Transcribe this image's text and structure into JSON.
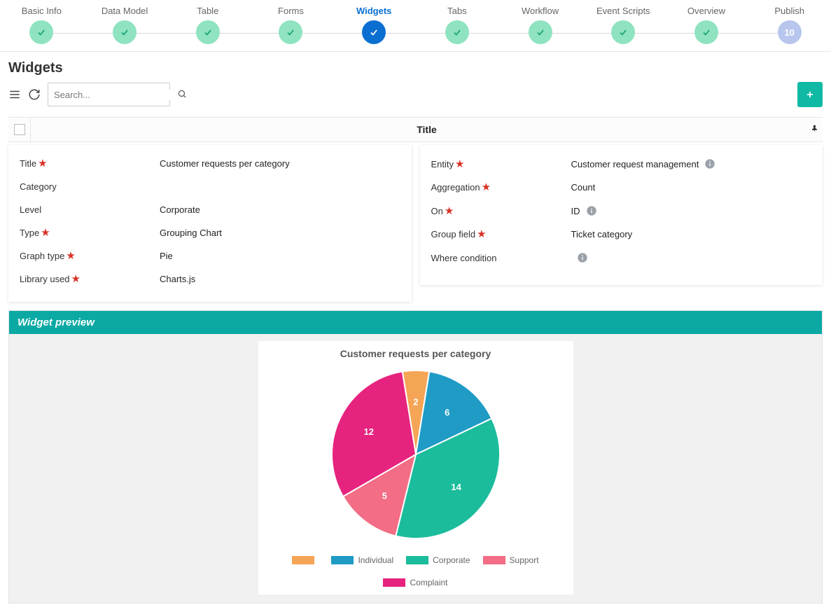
{
  "stepper": [
    {
      "label": "Basic Info",
      "done": true
    },
    {
      "label": "Data Model",
      "done": true
    },
    {
      "label": "Table",
      "done": true
    },
    {
      "label": "Forms",
      "done": true
    },
    {
      "label": "Widgets",
      "active": true
    },
    {
      "label": "Tabs",
      "done": true
    },
    {
      "label": "Workflow",
      "done": true
    },
    {
      "label": "Event Scripts",
      "done": true
    },
    {
      "label": "Overview",
      "done": true
    },
    {
      "label": "Publish",
      "number": "10",
      "publish": true
    }
  ],
  "page": {
    "title": "Widgets"
  },
  "search": {
    "placeholder": "Search..."
  },
  "table": {
    "title_header": "Title"
  },
  "left_fields": [
    {
      "label": "Title",
      "required": true,
      "value": "Customer requests per category"
    },
    {
      "label": "Category",
      "required": false,
      "value": ""
    },
    {
      "label": "Level",
      "required": false,
      "value": "Corporate"
    },
    {
      "label": "Type",
      "required": true,
      "value": "Grouping Chart"
    },
    {
      "label": "Graph type",
      "required": true,
      "value": "Pie"
    },
    {
      "label": "Library used",
      "required": true,
      "value": "Charts.js"
    }
  ],
  "right_fields": [
    {
      "label": "Entity",
      "required": true,
      "value": "Customer request management",
      "info": true
    },
    {
      "label": "Aggregation",
      "required": true,
      "value": "Count"
    },
    {
      "label": "On",
      "required": true,
      "value": "ID",
      "info": true
    },
    {
      "label": "Group field",
      "required": true,
      "value": "Ticket category"
    },
    {
      "label": "Where condition",
      "required": false,
      "value": "",
      "info": true
    }
  ],
  "preview": {
    "header": "Widget preview"
  },
  "chart_data": {
    "type": "pie",
    "title": "Customer requests per category",
    "series": [
      {
        "name": "",
        "value": 2,
        "color": "#f5a556"
      },
      {
        "name": "Individual",
        "value": 6,
        "color": "#1f9bc6"
      },
      {
        "name": "Corporate",
        "value": 14,
        "color": "#1abc9c"
      },
      {
        "name": "Support",
        "value": 5,
        "color": "#f26d85"
      },
      {
        "name": "Complaint",
        "value": 12,
        "color": "#e6237e"
      }
    ]
  }
}
